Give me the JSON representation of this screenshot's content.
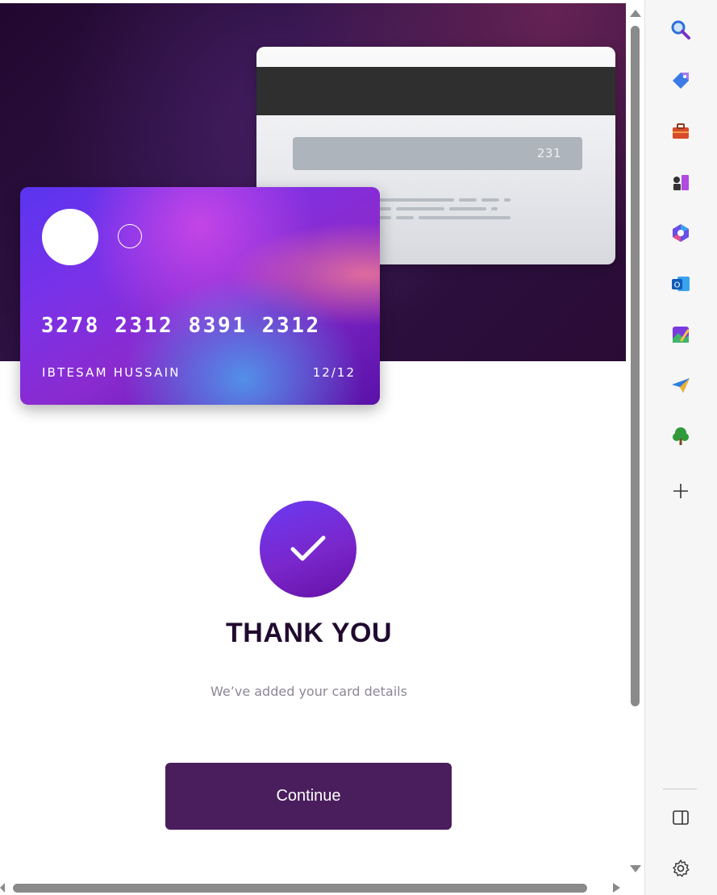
{
  "card": {
    "back": {
      "cvv": "231"
    },
    "front": {
      "number": "3278 2312 8391 2312",
      "holder": "IBTESAM HUSSAIN",
      "expiry": "12/12"
    }
  },
  "confirmation": {
    "icon": "check-icon",
    "title": "THANK YOU",
    "subtitle": "We’ve added your card details",
    "button_label": "Continue"
  },
  "colors": {
    "primary_button": "#4a1e5c",
    "heading": "#21092f",
    "accent_gradient_start": "#6a3af3",
    "accent_gradient_end": "#6510a4"
  },
  "sidebar": {
    "items": [
      {
        "name": "search-icon"
      },
      {
        "name": "shopping-tag-icon"
      },
      {
        "name": "tools-briefcase-icon"
      },
      {
        "name": "games-chess-icon"
      },
      {
        "name": "microsoft-365-icon"
      },
      {
        "name": "outlook-icon"
      },
      {
        "name": "image-creator-icon"
      },
      {
        "name": "send-drop-icon"
      },
      {
        "name": "tree-icon"
      },
      {
        "name": "add-icon"
      }
    ],
    "bottom": [
      {
        "name": "split-screen-icon"
      },
      {
        "name": "settings-gear-icon"
      }
    ]
  }
}
